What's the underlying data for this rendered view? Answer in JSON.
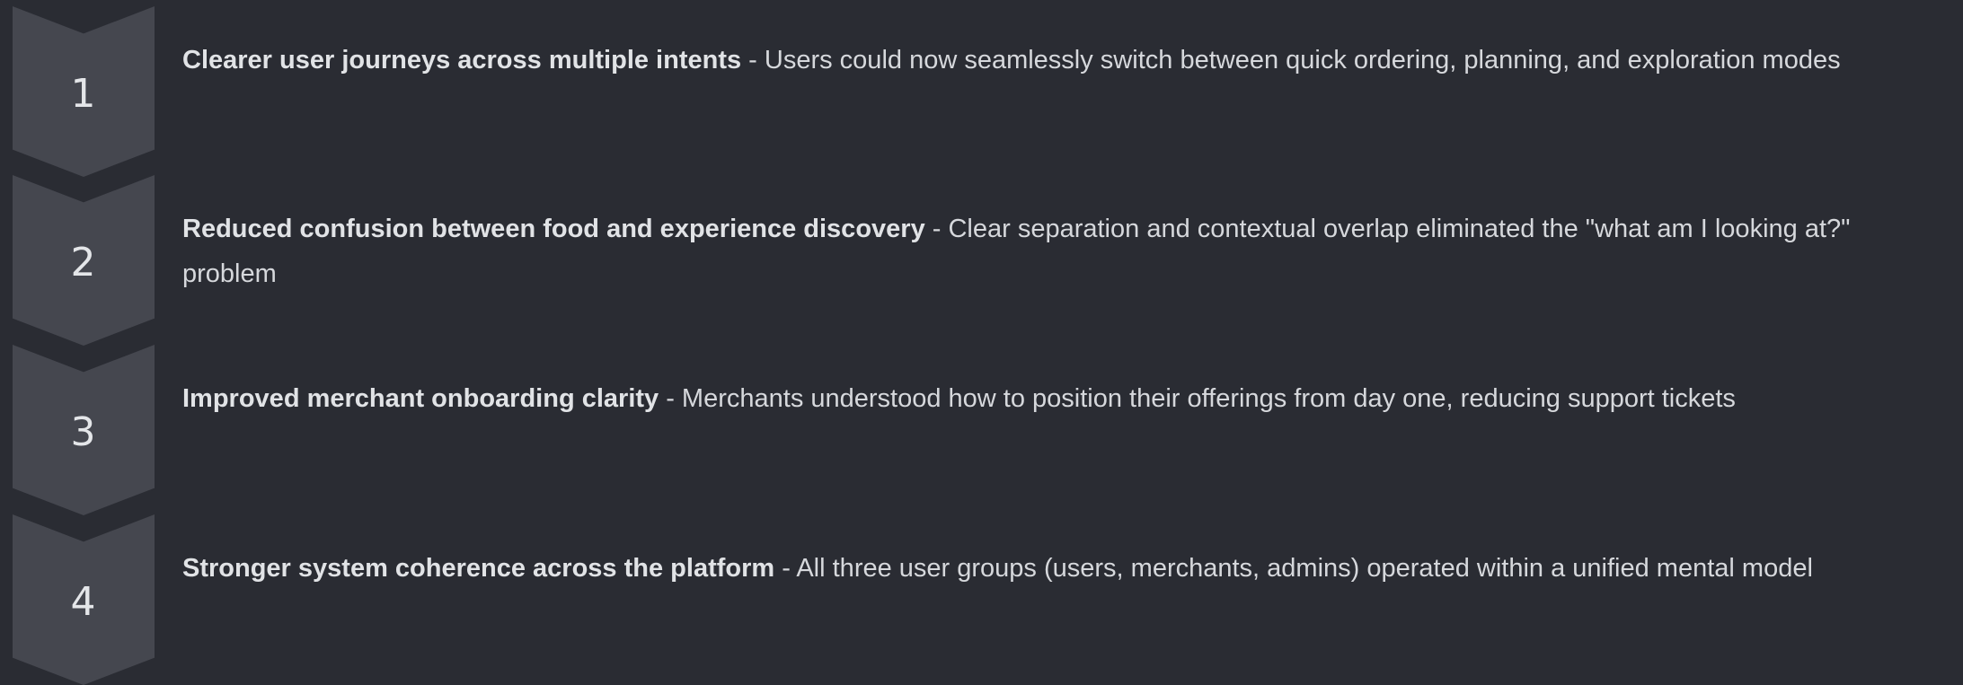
{
  "steps": [
    {
      "number": "1",
      "title": "Clearer user journeys across multiple intents",
      "description": " - Users could now seamlessly switch between quick ordering, planning, and exploration modes"
    },
    {
      "number": "2",
      "title": "Reduced confusion between food and experience discovery",
      "description": " - Clear separation and contextual overlap eliminated the \"what am I looking at?\" problem"
    },
    {
      "number": "3",
      "title": "Improved merchant onboarding clarity",
      "description": " - Merchants understood how to position their offerings from day one, reducing support tickets"
    },
    {
      "number": "4",
      "title": "Stronger system coherence across the platform",
      "description": " - All three user groups (users, merchants, admins) operated within a unified mental model"
    }
  ],
  "colors": {
    "background": "#2a2c33",
    "chevron": "#45474f",
    "text": "#d6d8dc"
  }
}
